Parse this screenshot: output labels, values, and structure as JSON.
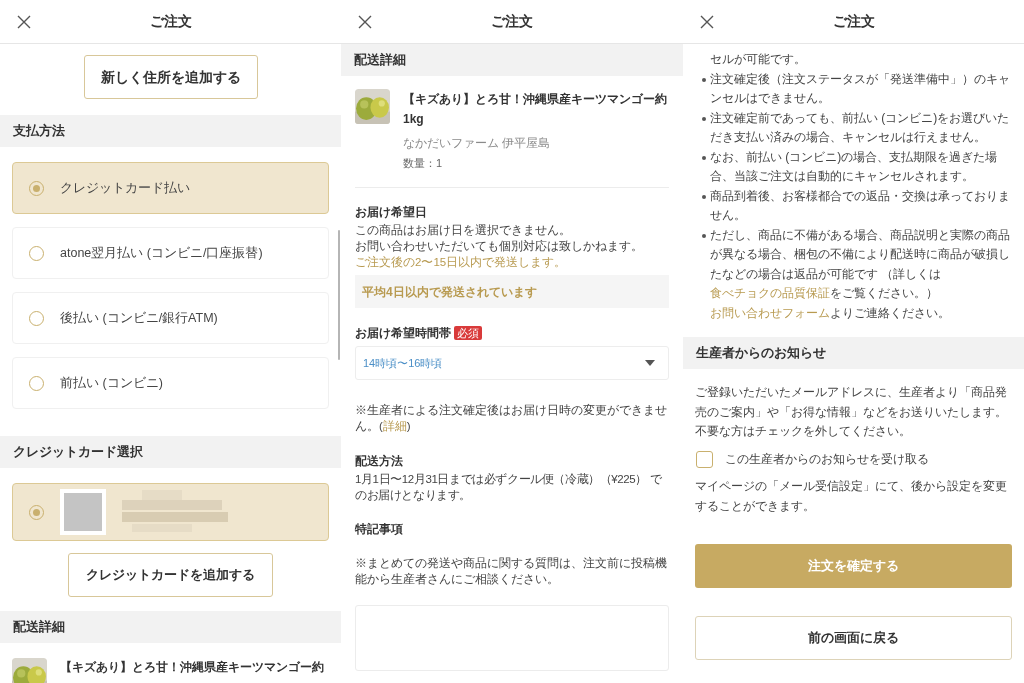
{
  "payment_panel": {
    "title": "ご注文",
    "add_address_button": "新しく住所を追加する",
    "payment_section": {
      "heading": "支払方法",
      "options": [
        {
          "label": "クレジットカード払い",
          "selected": true
        },
        {
          "label": "atone翌月払い (コンビニ/口座振替)",
          "selected": false
        },
        {
          "label": "後払い (コンビニ/銀行ATM)",
          "selected": false
        },
        {
          "label": "前払い (コンビニ)",
          "selected": false
        }
      ]
    },
    "card_section": {
      "heading": "クレジットカード選択",
      "cards": [
        {
          "selected": true
        }
      ],
      "add_card_button": "クレジットカードを追加する"
    },
    "shipping_section": {
      "heading": "配送詳細",
      "product_title": "【キズあり】とろ甘！沖縄県産キーツマンゴー約"
    }
  },
  "shipping_panel": {
    "title": "ご注文",
    "heading": "配送詳細",
    "product": {
      "title": "【キズあり】とろ甘！沖縄県産キーツマンゴー約1kg",
      "producer": "なかだいファーム 伊平屋島",
      "quantity": "数量：1"
    },
    "delivery_date": {
      "label": "お届け希望日",
      "lines": [
        {
          "text": "この商品はお届け日を選択できません。",
          "emphasis": false
        },
        {
          "text": "お問い合わせいただいても個別対応は致しかねます。",
          "emphasis": false
        },
        {
          "text": "ご注文後の2〜15日以内で発送します。",
          "emphasis": true
        }
      ],
      "average_note": "平均4日以内で発送されています"
    },
    "time_slot": {
      "label": "お届け希望時間帯",
      "required_badge": "必須",
      "value": "14時頃〜16時頃"
    },
    "change_note": [
      {
        "text": "※生産者による注文確定後はお届け日時の変更ができません。(",
        "link": false
      },
      {
        "text": "詳細",
        "link": true
      },
      {
        "text": ")",
        "link": false
      }
    ],
    "method": {
      "label": "配送方法",
      "text": "1月1日〜12月31日までは必ずクール便（冷蔵）（¥225） でのお届けとなります。"
    },
    "remarks": {
      "label": "特記事項",
      "note": "※まとめての発送や商品に関する質問は、注文前に投稿機能から生産者さんにご相談ください。"
    }
  },
  "notice_panel": {
    "title": "ご注文",
    "cancellation_items": [
      {
        "kind": "continuation",
        "parts": [
          {
            "text": "セルが可能です。",
            "link": false
          }
        ]
      },
      {
        "kind": "bullet",
        "parts": [
          {
            "text": "注文確定後（注文ステータスが「発送準備中」）のキャンセルはできません。",
            "link": false
          }
        ]
      },
      {
        "kind": "bullet",
        "parts": [
          {
            "text": "注文確定前であっても、前払い (コンビニ)をお選びいただき支払い済みの場合、キャンセルは行えません。",
            "link": false
          }
        ]
      },
      {
        "kind": "bullet",
        "parts": [
          {
            "text": "なお、前払い (コンビニ)の場合、支払期限を過ぎた場合、当該ご注文は自動的にキャンセルされます。",
            "link": false
          }
        ]
      },
      {
        "kind": "bullet",
        "parts": [
          {
            "text": "商品到着後、お客様都合での返品・交換は承っておりません。",
            "link": false
          }
        ]
      },
      {
        "kind": "bullet",
        "parts": [
          {
            "text": "ただし、商品に不備がある場合、商品説明と実際の商品が異なる場合、梱包の不備により配送時に商品が破損したなどの場合は返品が可能です （詳しくは",
            "link": false
          },
          {
            "text": "食べチョクの品質保証",
            "link": true
          },
          {
            "text": "をご覧ください。）",
            "link": false
          }
        ]
      },
      {
        "kind": "continuation",
        "parts": [
          {
            "text": "お問い合わせフォーム",
            "link": true
          },
          {
            "text": "よりご連絡ください。",
            "link": false
          }
        ]
      }
    ],
    "producer_notice": {
      "heading": "生産者からのお知らせ",
      "description_lines": [
        "ご登録いただいたメールアドレスに、生産者より「商品発売のご案内」や「お得な情報」などをお送りいたします。",
        "不要な方はチェックを外してください。"
      ],
      "checkbox": {
        "label": "この生産者からのお知らせを受け取る",
        "checked": false
      },
      "settings_note": "マイページの「メール受信設定」にて、後から設定を変更することができます。",
      "confirm_button": "注文を確定する",
      "back_button": "前の画面に戻る"
    }
  }
}
